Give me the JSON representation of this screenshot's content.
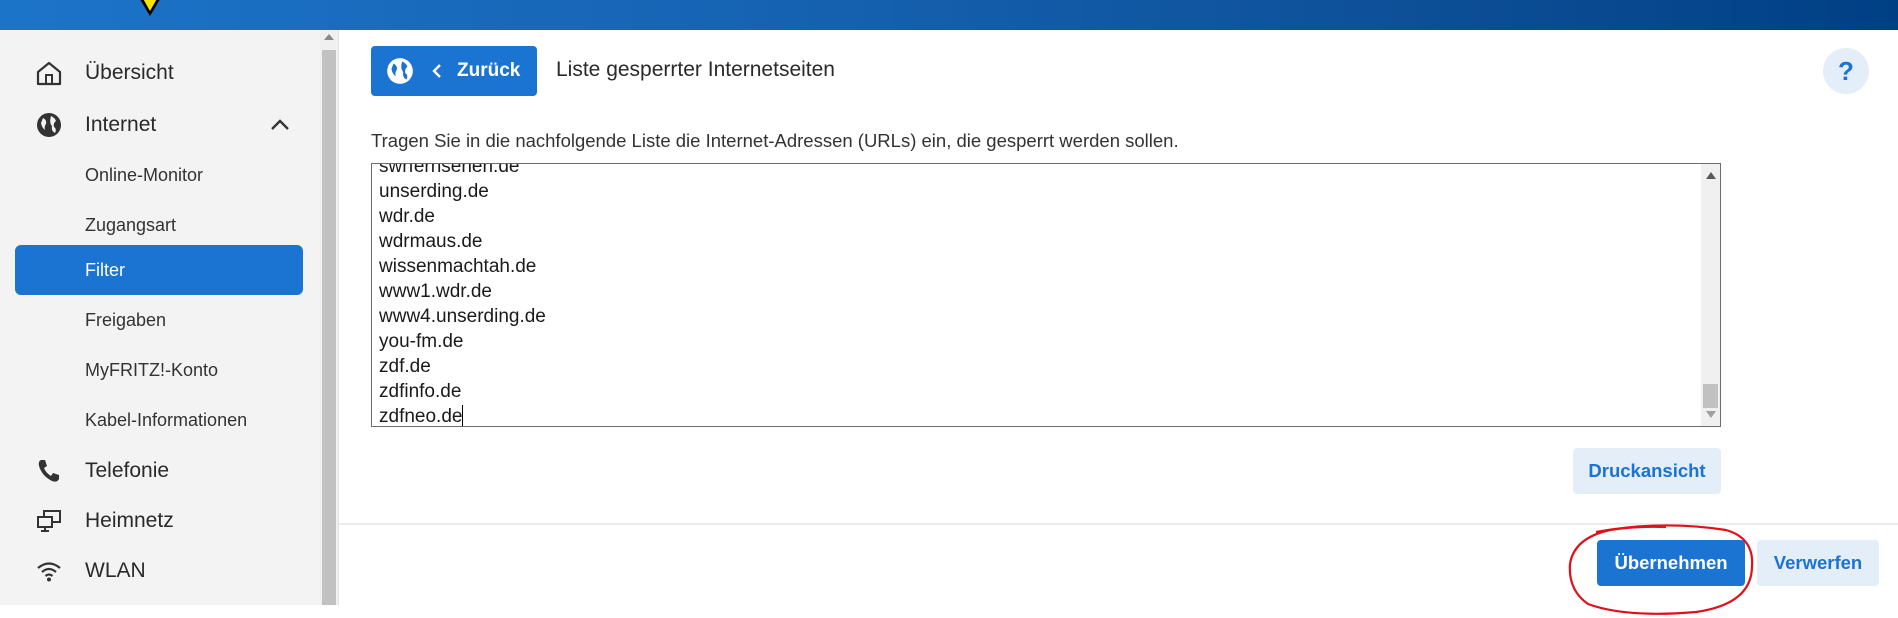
{
  "sidebar": {
    "items": [
      {
        "label": "Übersicht",
        "icon": "home-icon"
      },
      {
        "label": "Internet",
        "icon": "globe-icon"
      },
      {
        "label": "Telefonie",
        "icon": "phone-icon"
      },
      {
        "label": "Heimnetz",
        "icon": "network-icon"
      },
      {
        "label": "WLAN",
        "icon": "wifi-icon"
      }
    ],
    "internet_sub": [
      {
        "label": "Online-Monitor"
      },
      {
        "label": "Zugangsart"
      },
      {
        "label": "Filter",
        "active": true
      },
      {
        "label": "Freigaben"
      },
      {
        "label": "MyFRITZ!-Konto"
      },
      {
        "label": "Kabel-Informationen"
      }
    ]
  },
  "header": {
    "back_label": "Zurück",
    "title": "Liste gesperrter Internetseiten",
    "help_label": "?"
  },
  "main": {
    "instruction": "Tragen Sie in die nachfolgende Liste die Internet-Adressen (URLs) ein, die gesperrt werden sollen.",
    "url_list": [
      "swrfernsehen.de",
      "unserding.de",
      "wdr.de",
      "wdrmaus.de",
      "wissenmachtah.de",
      "www1.wdr.de",
      "www4.unserding.de",
      "you-fm.de",
      "zdf.de",
      "zdfinfo.de",
      "zdfneo.de"
    ],
    "print_label": "Druckansicht"
  },
  "footer": {
    "apply_label": "Übernehmen",
    "discard_label": "Verwerfen"
  },
  "colors": {
    "accent": "#1b73d2",
    "light_button": "#e3eef9",
    "annotation": "#e0101a"
  }
}
